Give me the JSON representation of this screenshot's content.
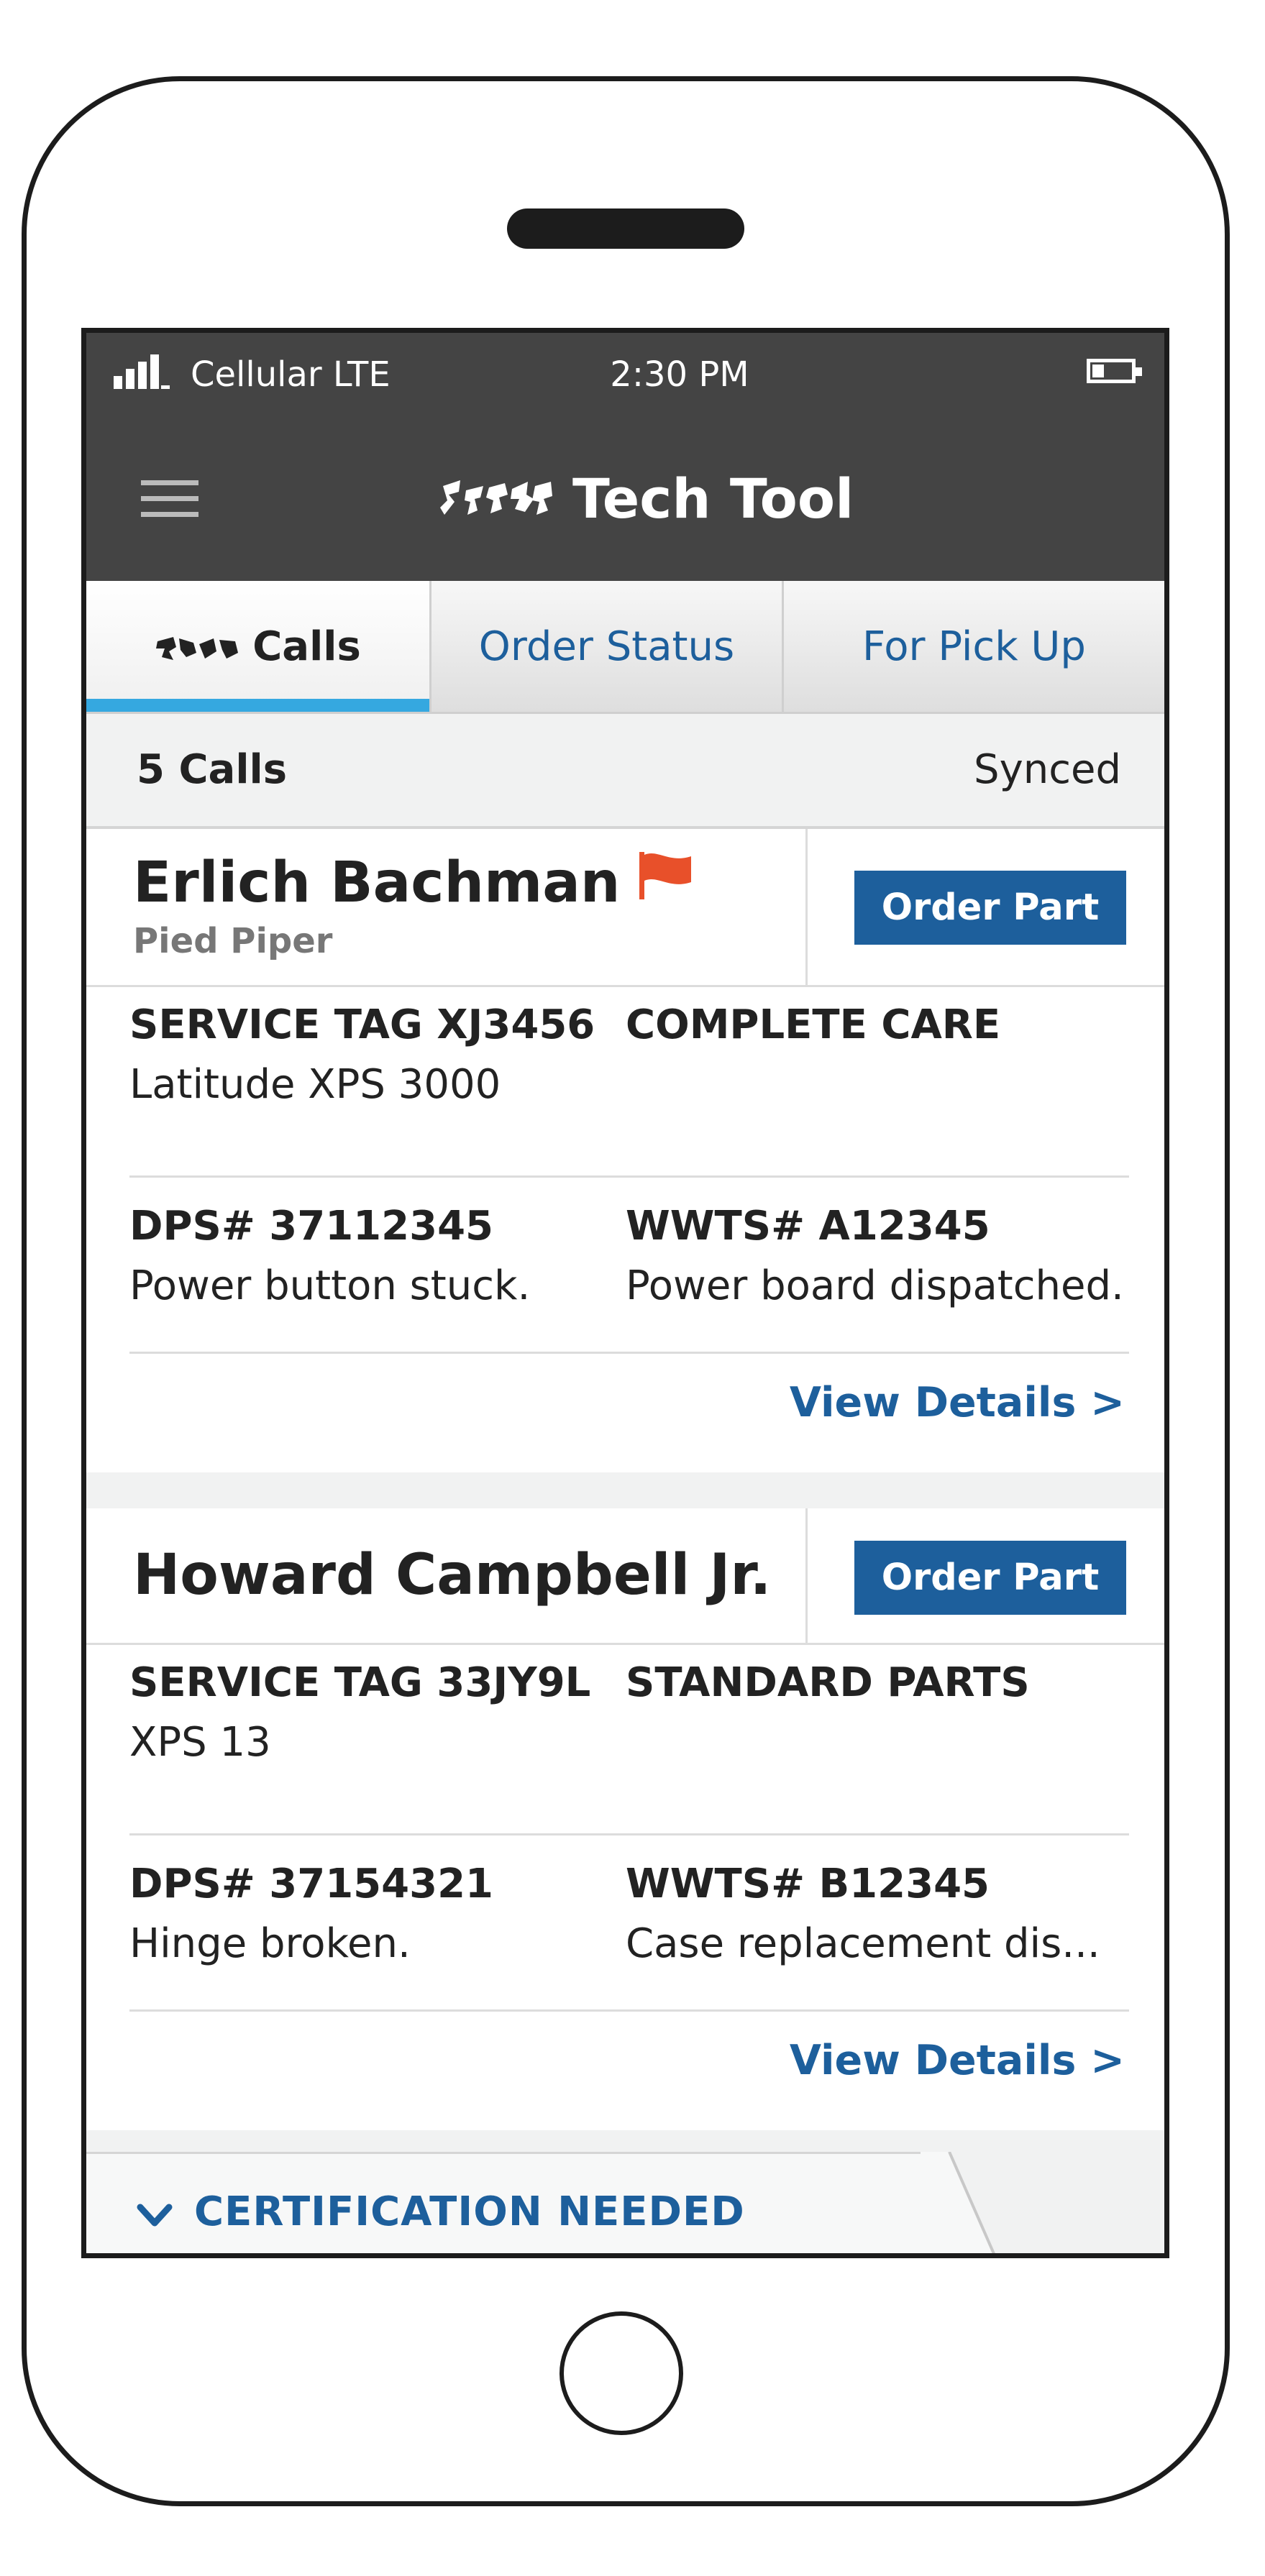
{
  "status_bar": {
    "carrier": "Cellular LTE",
    "time": "2:30 PM"
  },
  "header": {
    "title": "Tech Tool",
    "logo_icon": "brand-logo-icon",
    "menu_icon": "hamburger-icon"
  },
  "tabs": [
    {
      "label": "Calls",
      "active": true,
      "icon": "calls-icon"
    },
    {
      "label": "Order Status",
      "active": false
    },
    {
      "label": "For Pick Up",
      "active": false
    }
  ],
  "summary": {
    "count": "5 Calls",
    "sync_status": "Synced"
  },
  "calls": [
    {
      "customer": "Erlich Bachman",
      "company": "Pied Piper",
      "flagged": true,
      "order_button": "Order Part",
      "service_tag": "SERVICE TAG XJ3456",
      "model": "Latitude XPS 3000",
      "warranty": "COMPLETE CARE",
      "dps": "DPS# 37112345",
      "issue": "Power button stuck.",
      "wwts": "WWTS# A12345",
      "resolution": "Power board dispatched.",
      "view_details": "View Details >"
    },
    {
      "customer": "Howard Campbell Jr.",
      "order_button": "Order Part",
      "service_tag": "SERVICE TAG 33JY9L",
      "model": "XPS 13",
      "warranty": "STANDARD PARTS",
      "dps": "DPS# 37154321",
      "issue": "Hinge broken.",
      "wwts": "WWTS# B12345",
      "resolution": "Case replacement dis...",
      "view_details": "View Details >"
    }
  ],
  "certification": {
    "label": "CERTIFICATION NEEDED",
    "icon": "chevron-down-icon"
  },
  "colors": {
    "header_bg": "#444444",
    "accent_blue": "#1d5f9c",
    "tab_indicator": "#35a8e0",
    "flag": "#e8502a",
    "page_bg": "#f1f2f2"
  }
}
